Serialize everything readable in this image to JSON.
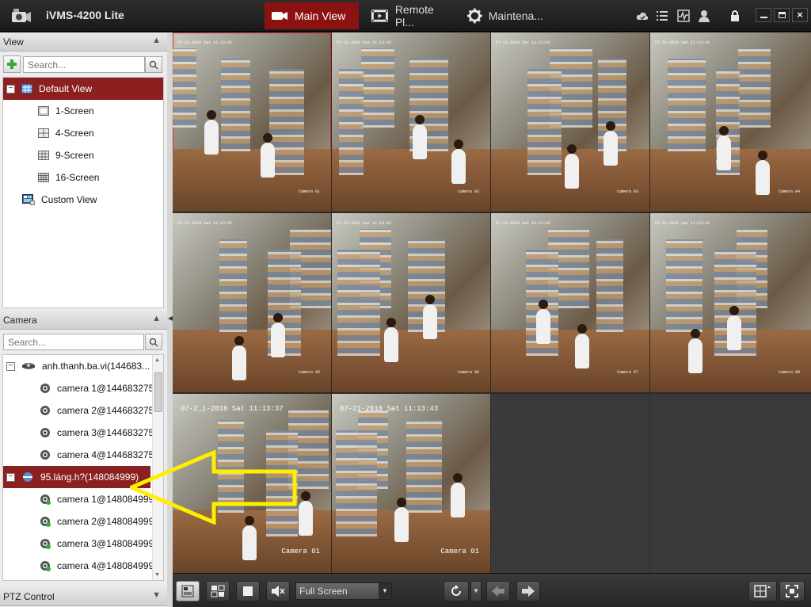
{
  "app": {
    "title": "iVMS-4200 Lite"
  },
  "nav_tabs": [
    {
      "label": "Main View",
      "icon": "video-camera-icon",
      "active": true
    },
    {
      "label": "Remote Pl...",
      "icon": "film-icon",
      "active": false
    },
    {
      "label": "Maintena...",
      "icon": "gear-icon",
      "active": false
    }
  ],
  "title_icons": [
    "cloud-icon",
    "list-icon",
    "pulse-icon",
    "user-icon",
    "lock-icon",
    "minimize-icon",
    "maximize-icon",
    "close-icon"
  ],
  "view_panel": {
    "title": "View",
    "search_placeholder": "Search...",
    "add_icon": "plus-icon",
    "items": [
      {
        "label": "Default View",
        "selected": true,
        "icon": "grid-icon"
      },
      {
        "label": "1-Screen",
        "icon": "screen-1-icon"
      },
      {
        "label": "4-Screen",
        "icon": "screen-4-icon"
      },
      {
        "label": "9-Screen",
        "icon": "screen-9-icon"
      },
      {
        "label": "16-Screen",
        "icon": "screen-16-icon"
      },
      {
        "label": "Custom View",
        "icon": "custom-view-icon"
      }
    ]
  },
  "camera_panel": {
    "title": "Camera",
    "search_placeholder": "Search...",
    "groups": [
      {
        "label": "anh.thanh.ba.vi(144683...",
        "selected": false,
        "cameras": [
          "camera 1@144683275",
          "camera 2@144683275",
          "camera 3@144683275",
          "camera 4@144683275"
        ]
      },
      {
        "label": "95.láng.h?(148084999)",
        "selected": true,
        "cameras": [
          "camera 1@148084999",
          "camera 2@148084999",
          "camera 3@148084999",
          "camera 4@148084999"
        ]
      }
    ]
  },
  "ptz_panel": {
    "title": "PTZ Control"
  },
  "video_grid": {
    "layout": "4x3",
    "cells": [
      {
        "timestamp": "07-21-2018 Sat 11:13:42",
        "label": "Camera 01",
        "selected": true
      },
      {
        "timestamp": "07-21-2018 Sat 11:13:42",
        "label": "Camera 02",
        "selected": false
      },
      {
        "timestamp": "07-21-2018 Sat 11:13:42",
        "label": "Camera 03",
        "selected": false
      },
      {
        "timestamp": "07-21-2018 Sat 11:13:42",
        "label": "Camera 04",
        "selected": false
      },
      {
        "timestamp": "07-21-2018 Sat 11:13:42",
        "label": "Camera 05",
        "selected": false
      },
      {
        "timestamp": "07-21-2018 Sat 11:13:42",
        "label": "Camera 06",
        "selected": false
      },
      {
        "timestamp": "07-21-2018 Sat 11:13:42",
        "label": "Camera 07",
        "selected": false
      },
      {
        "timestamp": "07-21-2018 Sat 11:13:42",
        "label": "Camera 08",
        "selected": false
      },
      {
        "timestamp": "07-2_1-2018 Sat 11:13:37",
        "label": "Camera 01",
        "selected": false,
        "big": true
      },
      {
        "timestamp": "07-21-2018 Sat 11:13:43",
        "label": "Camera 01",
        "selected": false,
        "big": true
      },
      {
        "empty": true
      },
      {
        "empty": true
      }
    ]
  },
  "bottom_toolbar": {
    "stream_mode": "Full Screen",
    "icons": [
      "layout-icon",
      "window-split-icon",
      "stop-all-icon",
      "mute-icon",
      "refresh-icon",
      "prev-page-icon",
      "next-page-icon",
      "grid-layout-icon",
      "fullscreen-icon"
    ]
  },
  "annotation": {
    "color": "#ffee00"
  },
  "colors": {
    "accent": "#8c1212",
    "selection": "#8c2020"
  }
}
